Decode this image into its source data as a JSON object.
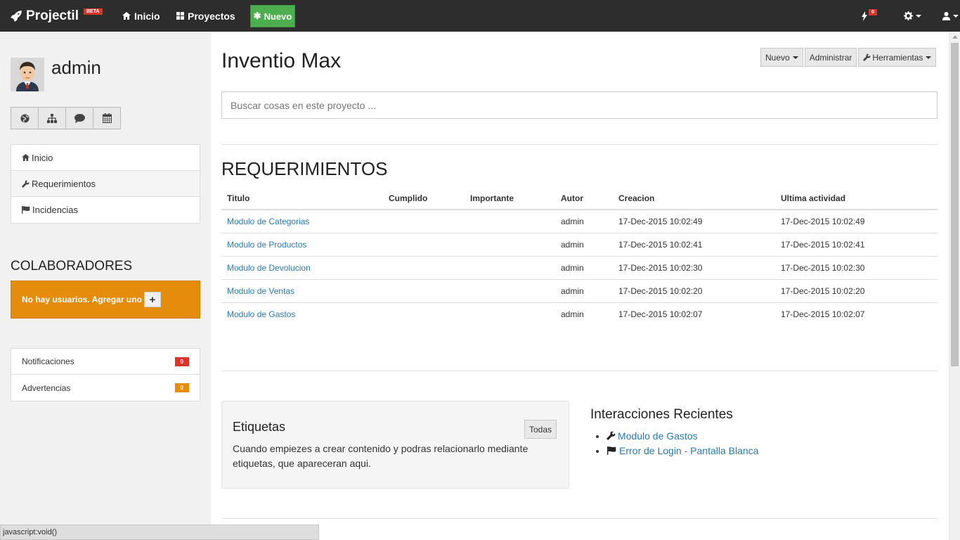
{
  "navbar": {
    "brand": "Projectil",
    "beta": "BETA",
    "inicio": "Inicio",
    "proyectos": "Proyectos",
    "nuevo": "Nuevo",
    "notif_count": "0"
  },
  "sidebar": {
    "username": "admin",
    "menu": [
      {
        "label": "Inicio",
        "icon": "home-icon"
      },
      {
        "label": "Requerimientos",
        "icon": "wrench-icon"
      },
      {
        "label": "Incidencias",
        "icon": "flag-icon"
      }
    ],
    "collab_title": "COLABORADORES",
    "collab_empty": "No hay usuarios. Agregar uno",
    "status": [
      {
        "label": "Notificaciones",
        "count": "0",
        "color": "#d9362b"
      },
      {
        "label": "Advertencias",
        "count": "0",
        "color": "#e68c0c"
      }
    ]
  },
  "main": {
    "project_title": "Inventio Max",
    "buttons": {
      "nuevo": "Nuevo",
      "administrar": "Administrar",
      "herramientas": "Herramientas"
    },
    "search_placeholder": "Buscar cosas en este proyecto ...",
    "req_title": "REQUERIMIENTOS",
    "table": {
      "headers": [
        "Titulo",
        "Cumplido",
        "Importante",
        "Autor",
        "Creacion",
        "Ultima actividad"
      ],
      "rows": [
        {
          "titulo": "Modulo de Categorias",
          "cumplido": "",
          "importante": "",
          "autor": "admin",
          "creacion": "17-Dec-2015 10:02:49",
          "ultima": "17-Dec-2015 10:02:49"
        },
        {
          "titulo": "Modulo de Productos",
          "cumplido": "",
          "importante": "",
          "autor": "admin",
          "creacion": "17-Dec-2015 10:02:41",
          "ultima": "17-Dec-2015 10:02:41"
        },
        {
          "titulo": "Modulo de Devolucion",
          "cumplido": "",
          "importante": "",
          "autor": "admin",
          "creacion": "17-Dec-2015 10:02:30",
          "ultima": "17-Dec-2015 10:02:30"
        },
        {
          "titulo": "Modulo de Ventas",
          "cumplido": "",
          "importante": "",
          "autor": "admin",
          "creacion": "17-Dec-2015 10:02:20",
          "ultima": "17-Dec-2015 10:02:20"
        },
        {
          "titulo": "Modulo de Gastos",
          "cumplido": "",
          "importante": "",
          "autor": "admin",
          "creacion": "17-Dec-2015 10:02:07",
          "ultima": "17-Dec-2015 10:02:07"
        }
      ]
    },
    "tags": {
      "title": "Etiquetas",
      "all_button": "Todas",
      "empty_text": "Cuando empiezes a crear contenido y podras relacionarlo mediante etiquetas, que apareceran aqui."
    },
    "interactions": {
      "title": "Interacciones Recientes",
      "items": [
        {
          "label": "Modulo de Gastos",
          "icon": "wrench-icon"
        },
        {
          "label": "Error de Login - Pantalla Blanca",
          "icon": "flag-icon"
        }
      ]
    }
  },
  "status_bar": "javascript:void()",
  "colors": {
    "navbar": "#2d2d2d",
    "new_button": "#4cae4c",
    "collab_box": "#e68c0c",
    "link": "#2a7ab0",
    "badge_red": "#d9362b",
    "badge_orange": "#e68c0c"
  }
}
